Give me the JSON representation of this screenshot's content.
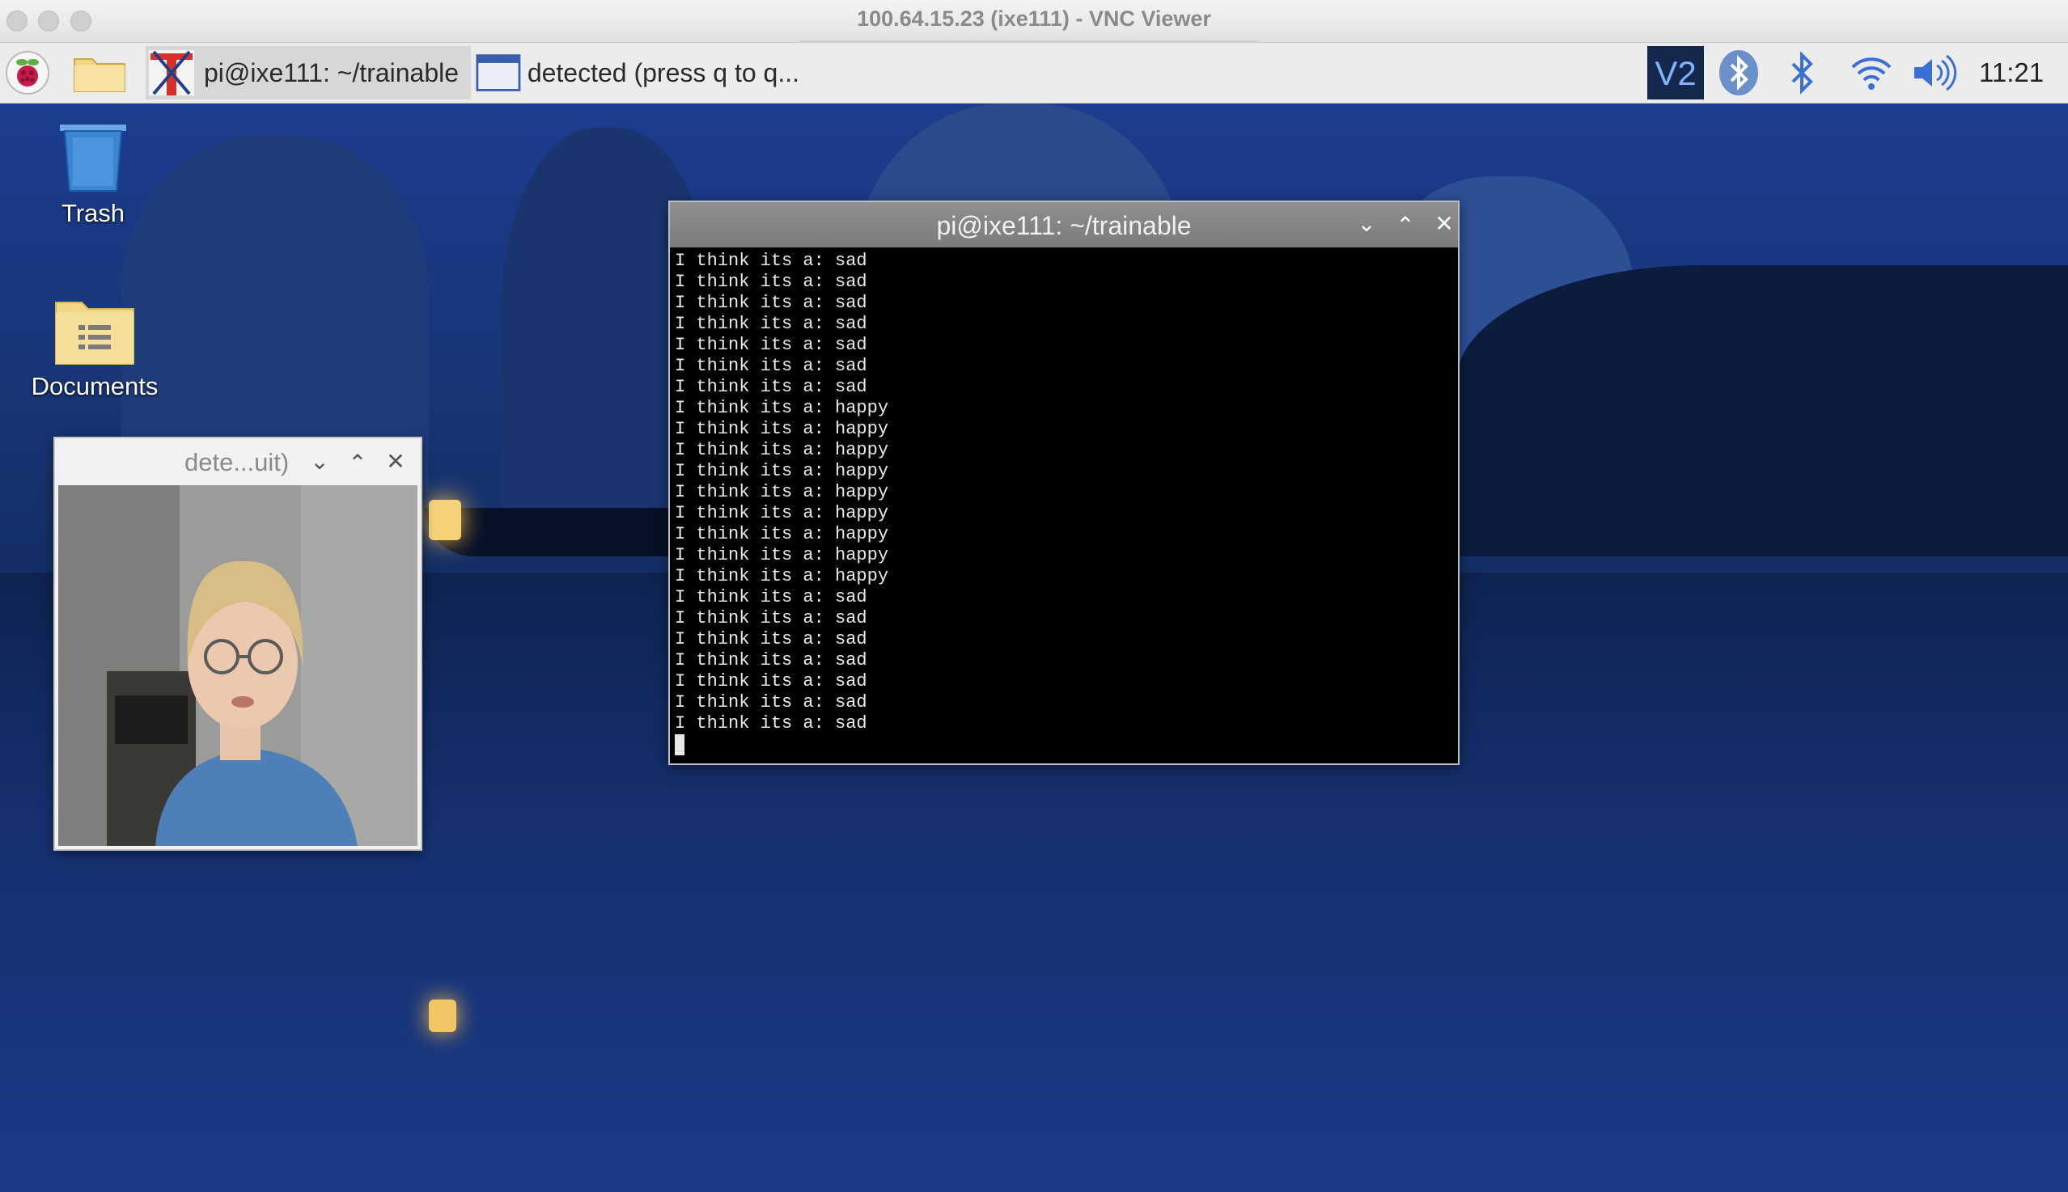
{
  "window": {
    "title": "100.64.15.23 (ixe111) - VNC Viewer"
  },
  "panel": {
    "launcher_icon": "raspberry-pi-icon",
    "file_manager_icon": "folder-icon",
    "tasks": [
      {
        "label": "pi@ixe111: ~/trainable",
        "icon": "terminal-icon",
        "active": true
      },
      {
        "label": "detected (press q to q...",
        "icon": "window-icon",
        "active": false
      }
    ],
    "tray": {
      "vnc_icon": "vnc-icon",
      "bluetooth_badge_icon": "bluetooth-icon",
      "bluetooth_icon": "bluetooth-icon",
      "wifi_icon": "wifi-icon",
      "volume_icon": "volume-icon",
      "clock": "11:21"
    }
  },
  "desktop": {
    "icons": [
      {
        "label": "Trash",
        "icon": "trash-icon"
      },
      {
        "label": "Documents",
        "icon": "documents-folder-icon"
      }
    ]
  },
  "terminal": {
    "title": "pi@ixe111: ~/trainable",
    "lines": [
      "I think its a: sad",
      "I think its a: sad",
      "I think its a: sad",
      "I think its a: sad",
      "I think its a: sad",
      "I think its a: sad",
      "I think its a: sad",
      "I think its a: happy",
      "I think its a: happy",
      "I think its a: happy",
      "I think its a: happy",
      "I think its a: happy",
      "I think its a: happy",
      "I think its a: happy",
      "I think its a: happy",
      "I think its a: happy",
      "I think its a: sad",
      "I think its a: sad",
      "I think its a: sad",
      "I think its a: sad",
      "I think its a: sad",
      "I think its a: sad",
      "I think its a: sad"
    ]
  },
  "detection_window": {
    "title": "dete...uit)"
  },
  "controls": {
    "minimize": "⌄",
    "maximize": "⌃",
    "close": "✕"
  }
}
